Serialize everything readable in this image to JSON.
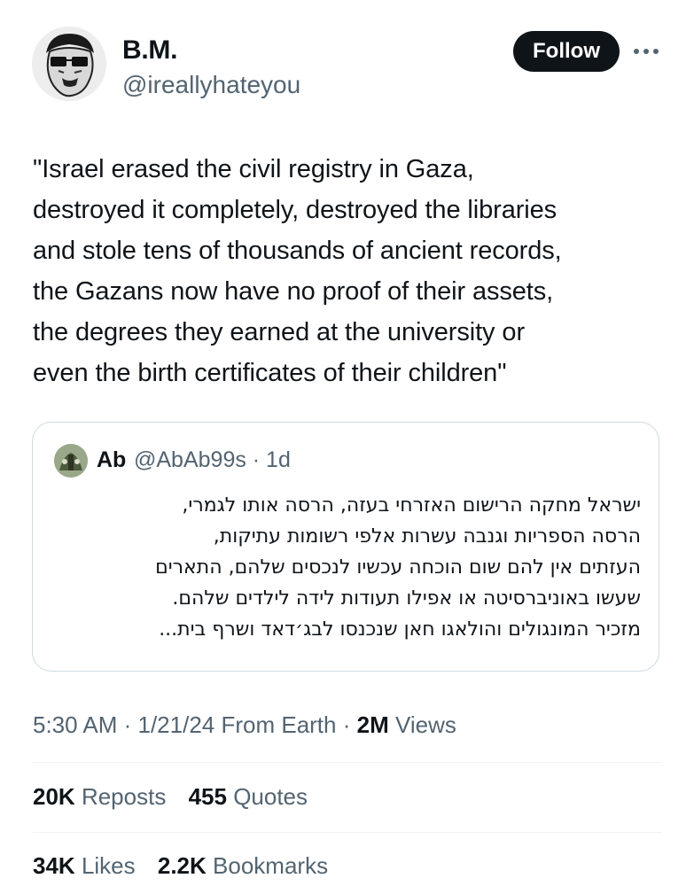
{
  "author": {
    "name": "B.M.",
    "handle": "@ireallyhateyou"
  },
  "follow_label": "Follow",
  "tweet": {
    "lines": [
      "\"Israel erased the civil registry in Gaza,",
      "destroyed it completely, destroyed the libraries",
      "and stole tens of thousands of ancient records,",
      "the Gazans now have no proof of their assets,",
      "the degrees they earned at the university or",
      "even the birth certificates of their children\""
    ]
  },
  "quote": {
    "name": "Ab",
    "handle_time": "@AbAb99s · 1d",
    "lines": [
      "ישראל מחקה הרישום האזרחי בעזה, הרסה אותו לגמרי,",
      "הרסה הספריות וגנבה עשרות אלפי רשומות עתיקות,",
      "העזתים אין להם שום הוכחה עכשיו לנכסים שלהם, התארים",
      "שעשו באוניברסיטה או אפילו תעודות לידה לילדים שלהם.",
      "מזכיר המונגולים והולאגו חאן שנכנסו לבג׳דאד ושרף בית..."
    ]
  },
  "meta": {
    "time_date": "5:30 AM · 1/21/24 From Earth · ",
    "views_count": "2M",
    "views_label": " Views"
  },
  "stats": {
    "reposts_count": "20K",
    "reposts_label": "Reposts",
    "quotes_count": "455",
    "quotes_label": "Quotes",
    "likes_count": "34K",
    "likes_label": "Likes",
    "bookmarks_count": "2.2K",
    "bookmarks_label": "Bookmarks"
  }
}
